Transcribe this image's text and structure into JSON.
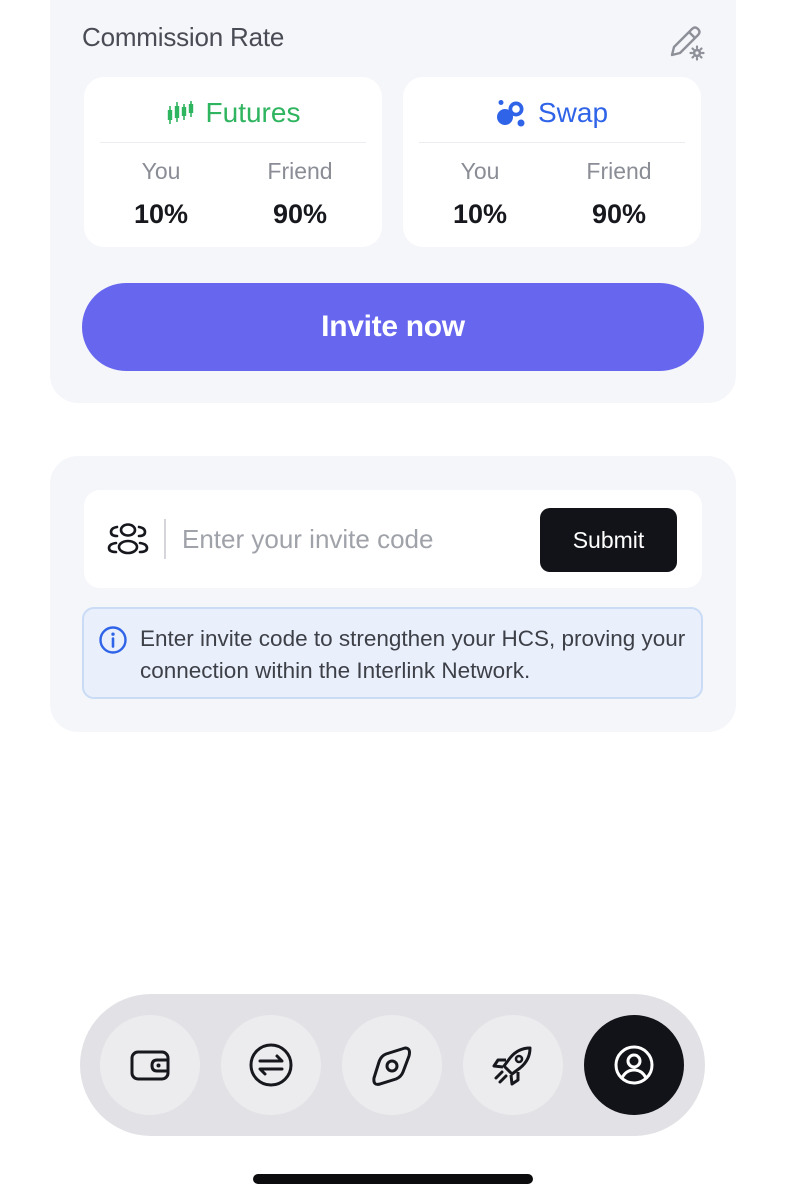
{
  "commission": {
    "title": "Commission Rate",
    "edit_icon": "pencil-settings-icon",
    "futures": {
      "name": "Futures",
      "icon": "candlestick-icon",
      "color": "#2fb45f",
      "you_label": "You",
      "you_value": "10%",
      "friend_label": "Friend",
      "friend_value": "90%"
    },
    "swap": {
      "name": "Swap",
      "icon": "swap-circles-icon",
      "color": "#2f63e8",
      "you_label": "You",
      "you_value": "10%",
      "friend_label": "Friend",
      "friend_value": "90%"
    },
    "invite_button": "Invite now",
    "accent_color": "#6766ef"
  },
  "invite_code": {
    "placeholder": "Enter your invite code",
    "value": "",
    "submit_label": "Submit",
    "info_text": "Enter invite code to strengthen your HCS, proving your connection within the Interlink Network."
  },
  "bottom_nav": {
    "items": [
      {
        "icon": "wallet-icon",
        "active": false
      },
      {
        "icon": "exchange-icon",
        "active": false
      },
      {
        "icon": "compass-icon",
        "active": false
      },
      {
        "icon": "rocket-icon",
        "active": false
      },
      {
        "icon": "profile-icon",
        "active": true
      }
    ]
  }
}
